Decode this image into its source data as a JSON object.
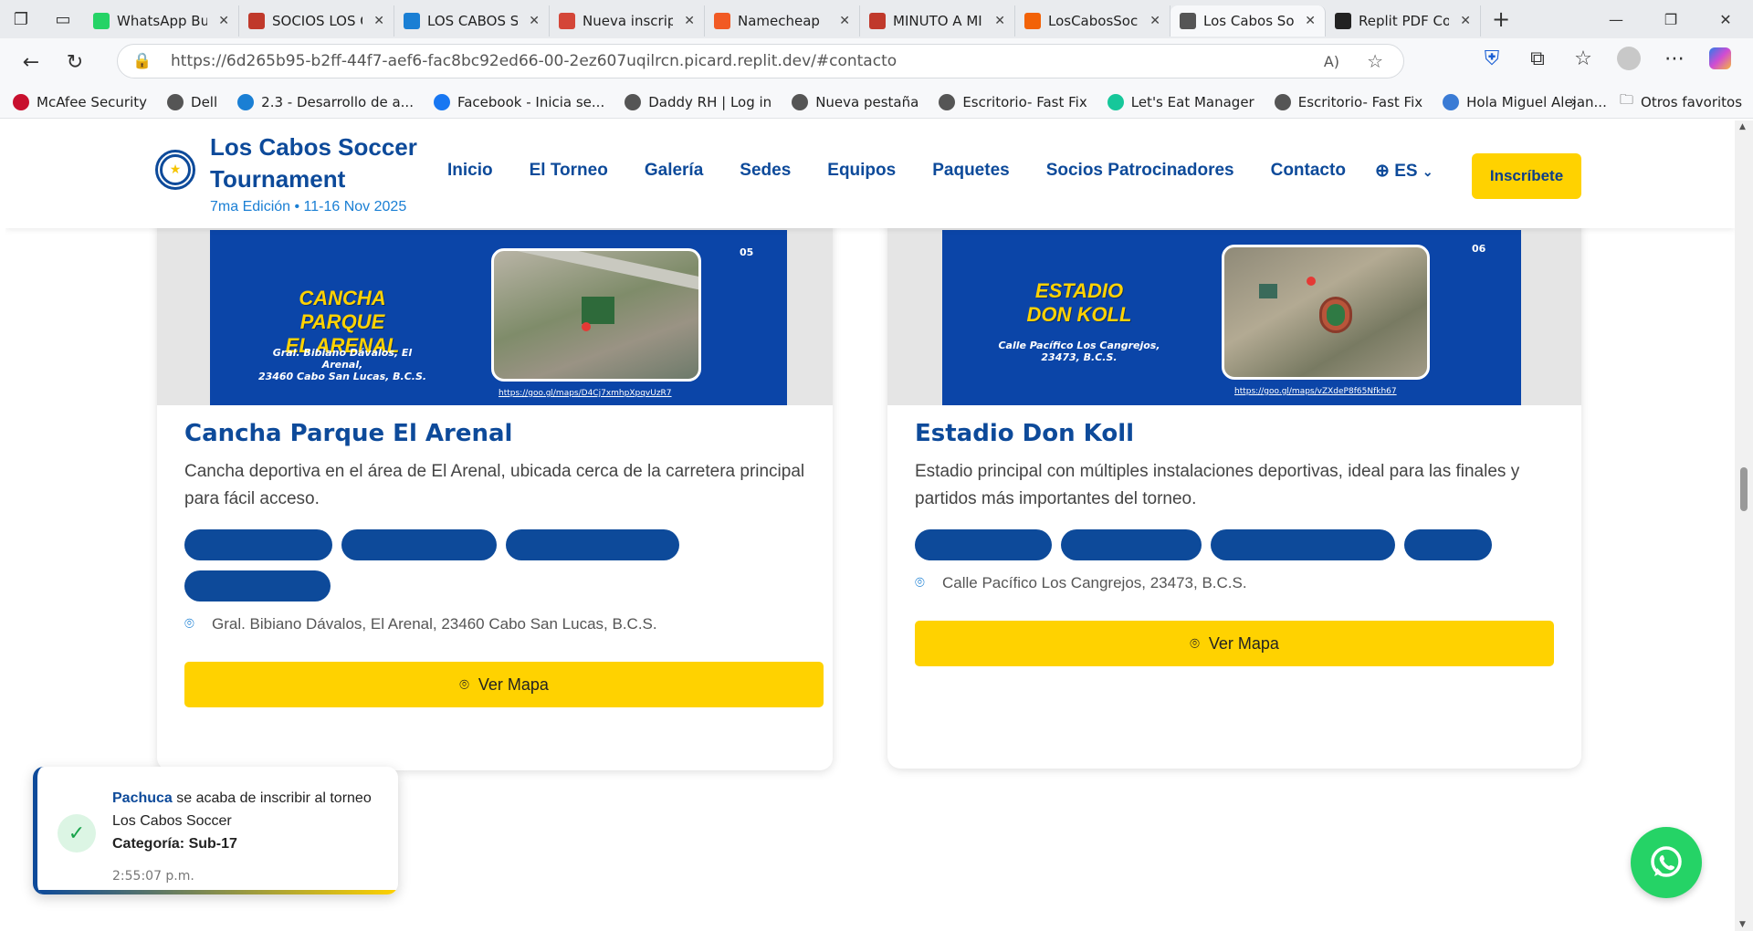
{
  "browser": {
    "tabs": [
      {
        "title": "WhatsApp Bu",
        "color": "#25d366",
        "icon": "whatsapp-icon"
      },
      {
        "title": "SOCIOS LOS C",
        "color": "#c0392b",
        "icon": "pdf-icon"
      },
      {
        "title": "LOS CABOS SC",
        "color": "#1a7fd4",
        "icon": "site-icon"
      },
      {
        "title": "Nueva inscripc",
        "color": "#d44638",
        "icon": "gmail-icon"
      },
      {
        "title": "Namecheap",
        "color": "#f15a24",
        "icon": "namecheap-icon"
      },
      {
        "title": "MINUTO A MI",
        "color": "#c0392b",
        "icon": "pdf-icon"
      },
      {
        "title": "LosCabosSocc",
        "color": "#f26207",
        "icon": "replit-icon"
      },
      {
        "title": "Los Cabos Soc",
        "color": "#555555",
        "icon": "globe-icon"
      },
      {
        "title": "Replit PDF Co",
        "color": "#222222",
        "icon": "openai-icon"
      }
    ],
    "url": "https://6d265b95-b2ff-44f7-aef6-fac8bc92ed66-00-2ez607uqilrcn.picard.replit.dev/#contacto",
    "bookmarks": [
      {
        "label": "McAfee Security",
        "color": "#c8102e"
      },
      {
        "label": "Dell",
        "color": "#555555"
      },
      {
        "label": "2.3 - Desarrollo de a...",
        "color": "#1a7fd4"
      },
      {
        "label": "Facebook - Inicia se...",
        "color": "#1877f2"
      },
      {
        "label": "Daddy RH | Log in",
        "color": "#555555"
      },
      {
        "label": "Nueva pestaña",
        "color": "#555555"
      },
      {
        "label": "Escritorio- Fast Fix",
        "color": "#555555"
      },
      {
        "label": "Let's Eat Manager",
        "color": "#16c79a"
      },
      {
        "label": "Escritorio- Fast Fix",
        "color": "#555555"
      },
      {
        "label": "Hola Miguel Alejan...",
        "color": "#3a7bd5"
      }
    ],
    "other_favorites": "Otros favoritos"
  },
  "site": {
    "brand_line1": "Los Cabos Soccer",
    "brand_line2": "Tournament",
    "edition": "7ma Edición • 11-16 Nov 2025",
    "menu": [
      "Inicio",
      "El Torneo",
      "Galería",
      "Sedes",
      "Equipos",
      "Paquetes",
      "Socios Patrocinadores",
      "Contacto"
    ],
    "lang": "ES",
    "cta": "Inscríbete"
  },
  "venues": [
    {
      "poster_title1": "CANCHA PARQUE",
      "poster_title2": "EL ARENAL",
      "poster_addr1": "Gral. Bibiano Dávalos, El Arenal,",
      "poster_addr2": "23460 Cabo San Lucas, B.C.S.",
      "poster_num": "05",
      "poster_link": "https://goo.gl/maps/D4Cj7xmhpXpqvUzR7",
      "title": "Cancha Parque El Arenal",
      "description": "Cancha deportiva en el área de El Arenal, ubicada cerca de la carretera principal para fácil acceso.",
      "address": "Gral. Bibiano Dávalos, El Arenal, 23460 Cabo San Lucas, B.C.S.",
      "button": "Ver Mapa"
    },
    {
      "poster_title1": "ESTADIO",
      "poster_title2": "DON KOLL",
      "poster_addr1": "Calle Pacífico Los Cangrejos,",
      "poster_addr2": "23473, B.C.S.",
      "poster_num": "06",
      "poster_link": "https://goo.gl/maps/vZXdeP8f65Nfkh67",
      "title": "Estadio Don Koll",
      "description": "Estadio principal con múltiples instalaciones deportivas, ideal para las finales y partidos más importantes del torneo.",
      "address": "Calle Pacífico Los Cangrejos, 23473, B.C.S.",
      "button": "Ver Mapa"
    }
  ],
  "toast": {
    "team": "Pachuca",
    "text": " se acaba de inscribir al torneo Los Cabos Soccer",
    "category": "Categoría: Sub-17",
    "time": "2:55:07 p.m."
  },
  "colors": {
    "primary": "#0d4a9a",
    "accent": "#ffd200",
    "whatsapp": "#25d366"
  }
}
